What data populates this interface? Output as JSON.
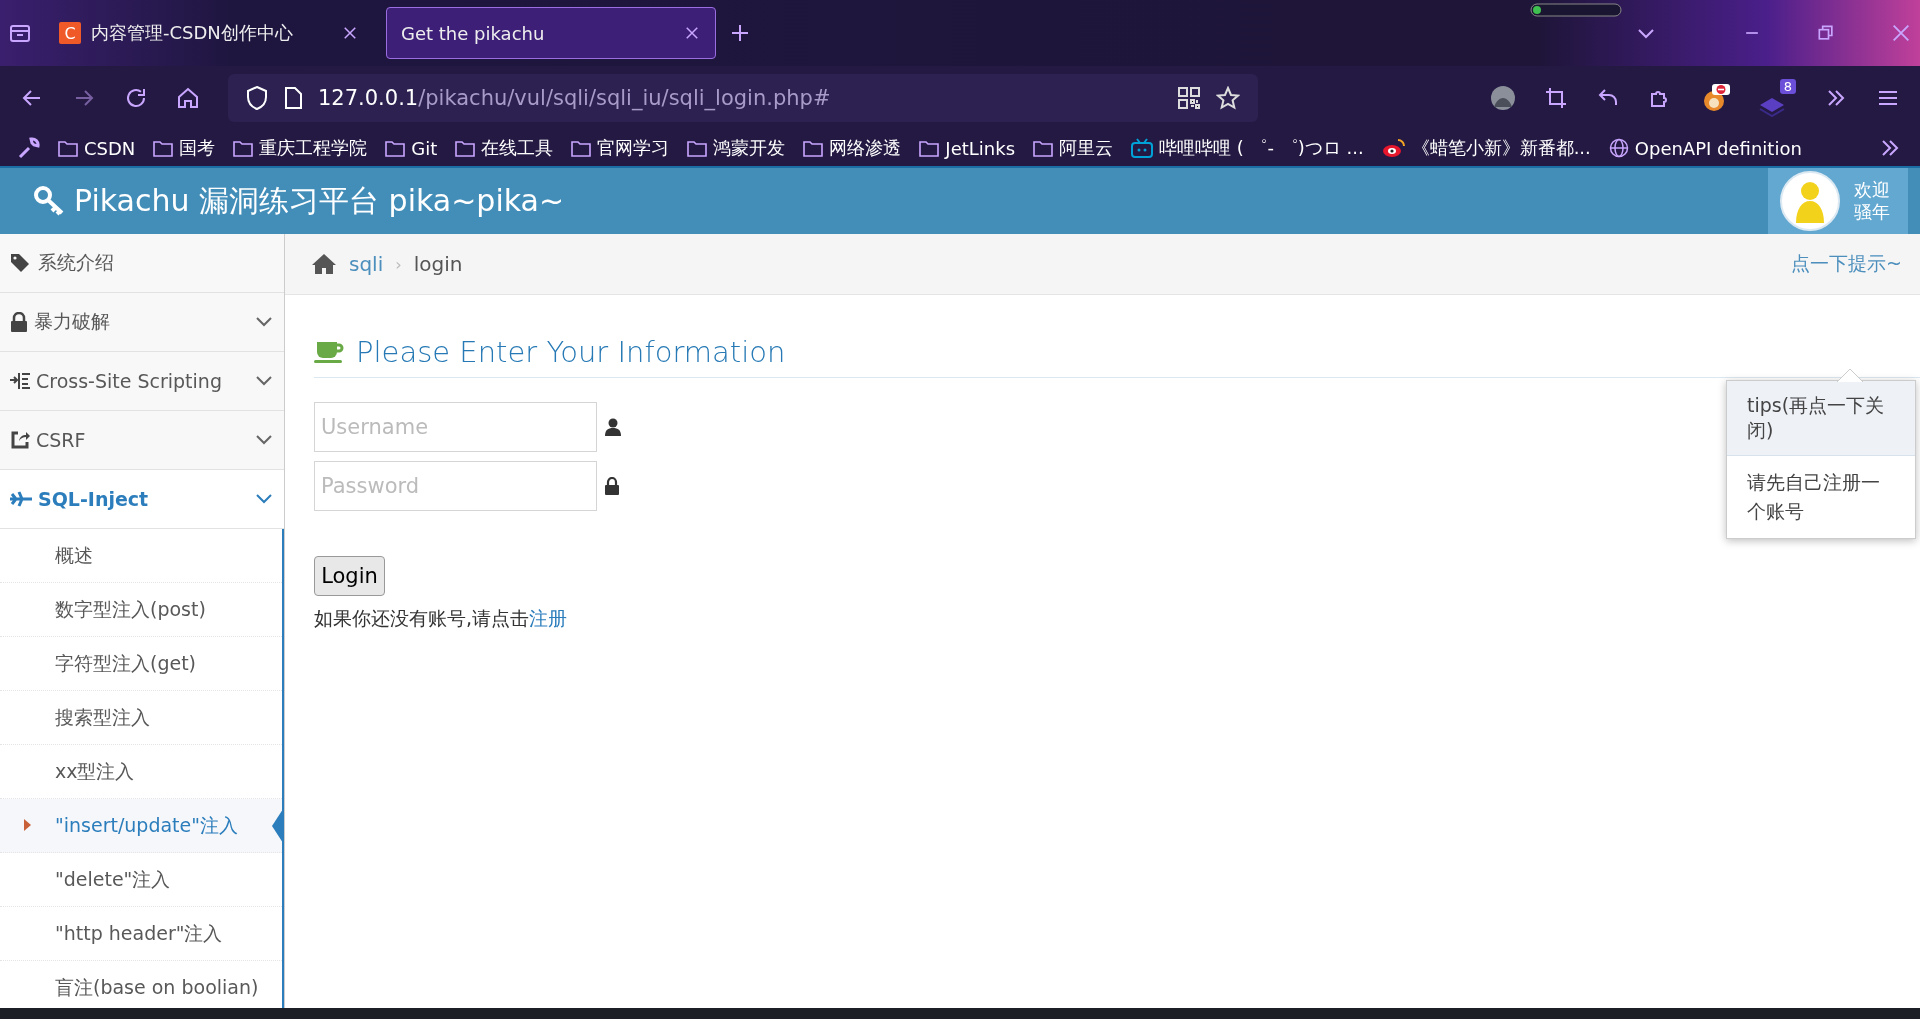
{
  "browser": {
    "tabs": [
      {
        "title": "内容管理-CSDN创作中心",
        "favicon": "C",
        "selected": false
      },
      {
        "title": "Get the pikachu",
        "selected": true
      }
    ],
    "address": {
      "host": "127.0.0.1",
      "path": "/pikachu/vul/sqli/sqli_iu/sqli_login.php#"
    },
    "extension_badge": "8",
    "bookmarks": [
      {
        "label": "CSDN",
        "kind": "folder"
      },
      {
        "label": "国考",
        "kind": "folder"
      },
      {
        "label": "重庆工程学院",
        "kind": "folder"
      },
      {
        "label": "Git",
        "kind": "folder"
      },
      {
        "label": "在线工具",
        "kind": "folder"
      },
      {
        "label": "官网学习",
        "kind": "folder"
      },
      {
        "label": "鸿蒙开发",
        "kind": "folder"
      },
      {
        "label": "网络渗透",
        "kind": "folder"
      },
      {
        "label": "JetLinks",
        "kind": "folder"
      },
      {
        "label": "阿里云",
        "kind": "folder"
      },
      {
        "label": "哔哩哔哩 ( ゜- ゜)つロ ...",
        "kind": "tv"
      },
      {
        "label": "《蜡笔小新》新番都...",
        "kind": "weibo"
      },
      {
        "label": "OpenAPI definition",
        "kind": "globe"
      }
    ]
  },
  "header": {
    "title": "Pikachu 漏洞练习平台 pika~pika~",
    "welcome": "欢迎",
    "user": "骚年"
  },
  "sidebar": {
    "items": [
      {
        "label": "系统介绍",
        "kind": "link",
        "selected": false
      },
      {
        "label": "暴力破解",
        "kind": "group",
        "selected": false,
        "expanded": false
      },
      {
        "label": "Cross-Site Scripting",
        "kind": "group",
        "selected": false,
        "expanded": false
      },
      {
        "label": "CSRF",
        "kind": "group",
        "selected": false,
        "expanded": false
      },
      {
        "label": "SQL-Inject",
        "kind": "group",
        "selected": true,
        "expanded": true,
        "children": [
          {
            "label": "概述",
            "selected": false
          },
          {
            "label": "数字型注入(post)",
            "selected": false
          },
          {
            "label": "字符型注入(get)",
            "selected": false
          },
          {
            "label": "搜索型注入",
            "selected": false
          },
          {
            "label": "xx型注入",
            "selected": false
          },
          {
            "label": "\"insert/update\"注入",
            "selected": true
          },
          {
            "label": "\"delete\"注入",
            "selected": false
          },
          {
            "label": "\"http header\"注入",
            "selected": false
          },
          {
            "label": "盲注(base on boolian)",
            "selected": false
          }
        ]
      }
    ]
  },
  "breadcrumb": {
    "section": "sqli",
    "separator": "›",
    "page": "login",
    "hint_link": "点一下提示~"
  },
  "tips": {
    "title": "tips(再点一下关闭)",
    "body": "请先自己注册一个账号"
  },
  "form": {
    "heading": "Please Enter Your Information",
    "username_placeholder": "Username",
    "password_placeholder": "Password",
    "submit": "Login",
    "register_prompt": "如果你还没有账号,请点击",
    "register_link": "注册"
  }
}
